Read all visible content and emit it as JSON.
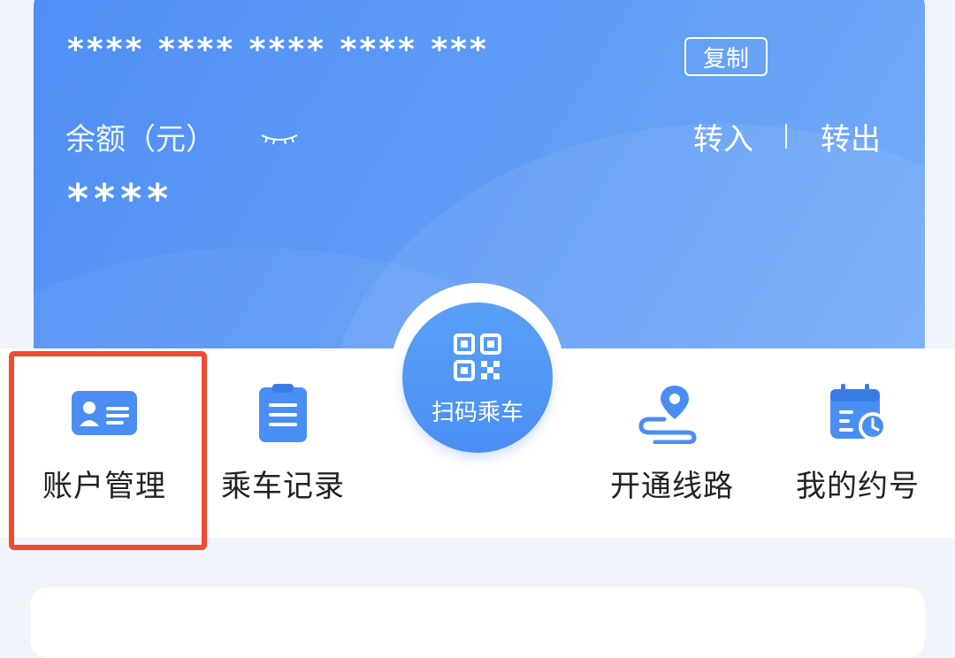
{
  "card": {
    "number_masked": "**** **** **** **** ***",
    "copy_label": "复制",
    "balance_label": "余额（元）",
    "balance_value": "****",
    "transfer_in": "转入",
    "transfer_out": "转出"
  },
  "scan": {
    "label": "扫码乘车"
  },
  "nav": {
    "items": [
      {
        "label": "账户管理",
        "icon": "id-card-icon"
      },
      {
        "label": "乘车记录",
        "icon": "clipboard-icon"
      },
      {
        "label": "开通线路",
        "icon": "route-icon"
      },
      {
        "label": "我的约号",
        "icon": "calendar-clock-icon"
      }
    ]
  },
  "colors": {
    "card_blue": "#5d9af6",
    "icon_blue": "#4b8ef3",
    "highlight_red": "#f24a2f",
    "text_dark": "#222222"
  }
}
